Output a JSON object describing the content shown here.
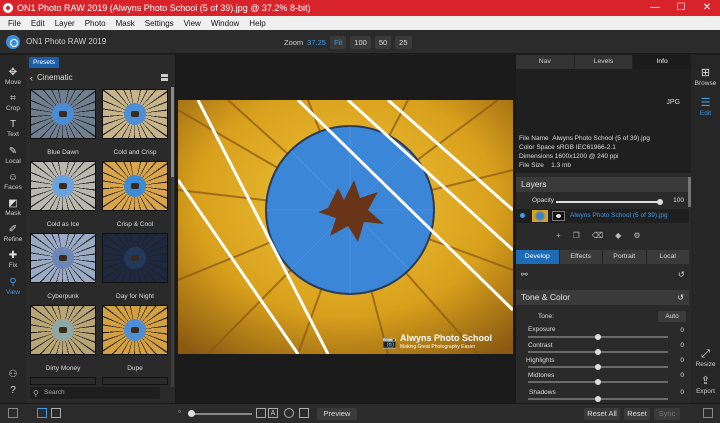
{
  "window": {
    "title": "ON1 Photo RAW 2019 (Alwyns Photo School (5 of 39).jpg @ 37.2% 8-bit)",
    "controls": [
      "—",
      "☐",
      "✕"
    ]
  },
  "menu": [
    "File",
    "Edit",
    "Layer",
    "Photo",
    "Mask",
    "Settings",
    "View",
    "Window",
    "Help"
  ],
  "header": {
    "app_name": "ON1 Photo RAW 2019",
    "zoom_label": "Zoom",
    "zoom_value": "37.25",
    "zoom_buttons": [
      "Fit",
      "100",
      "50",
      "25"
    ]
  },
  "tools": [
    {
      "label": "Move",
      "icon": "✥"
    },
    {
      "label": "Crop",
      "icon": "⌗"
    },
    {
      "label": "Text",
      "icon": "T"
    },
    {
      "label": "Local",
      "icon": "✎"
    },
    {
      "label": "Faces",
      "icon": "☺"
    },
    {
      "label": "Mask",
      "icon": "◩"
    },
    {
      "label": "Refine",
      "icon": "✐"
    },
    {
      "label": "Fix",
      "icon": "✚"
    },
    {
      "label": "View",
      "icon": "⚲"
    }
  ],
  "tool_active": "View",
  "presets": {
    "tab": "Presets",
    "category": "Cinematic",
    "items": [
      {
        "label": "Blue Dawn",
        "tone": "#6f7f8f",
        "center": "#4a8dd6"
      },
      {
        "label": "Cold and Crisp",
        "tone": "#c8b48a",
        "center": "#4b8fd8"
      },
      {
        "label": "Cold as Ice",
        "tone": "#b9b8ae",
        "center": "#6aa3e0"
      },
      {
        "label": "Crisp & Cool",
        "tone": "#d8a54c",
        "center": "#3d8bd6"
      },
      {
        "label": "Cyberpunk",
        "tone": "#9aa9c4",
        "center": "#6c86b5"
      },
      {
        "label": "Day for Night",
        "tone": "#1e2940",
        "center": "#23395c"
      },
      {
        "label": "Dirty Money",
        "tone": "#b8a676",
        "center": "#8fa7a5"
      },
      {
        "label": "Dupe",
        "tone": "#d4a142",
        "center": "#4e8ed4"
      }
    ],
    "search_placeholder": "Search"
  },
  "photo": {
    "watermark_title": "Alwyns Photo School",
    "watermark_sub": "Making Great Photography Easier"
  },
  "right_panel": {
    "tabs": [
      "Nav",
      "Levels",
      "Info"
    ],
    "active_tab": "Info",
    "format": "JPG",
    "info": [
      {
        "k": "File Name",
        "v": "Alwyns Photo School (5 of 39).jpg"
      },
      {
        "k": "Color Space",
        "v": "sRGB IEC61966-2.1"
      },
      {
        "k": "Dimensions",
        "v": "1600x1200 @ 240 ppi"
      },
      {
        "k": "File Size",
        "v": "1.3 mb"
      }
    ],
    "layers": {
      "title": "Layers",
      "opacity_label": "Opacity",
      "opacity_value": "100",
      "opacity_level": 100,
      "layer_name": "Alwyns Photo School (5 of 39).jpg",
      "icons": [
        "+",
        "❐",
        "⌫",
        "◆",
        "⚙"
      ]
    },
    "module_tabs": [
      "Develop",
      "Effects",
      "Portrait",
      "Local"
    ],
    "active_module": "Develop",
    "tone_color": {
      "title": "Tone & Color",
      "tone_label": "Tone:",
      "auto_label": "Auto",
      "sliders": [
        {
          "label": "Exposure",
          "value": "0",
          "level": 0
        },
        {
          "label": "Contrast",
          "value": "0",
          "level": 0
        },
        {
          "label": "Highlights",
          "value": "0",
          "level": 0
        },
        {
          "label": "Midtones",
          "value": "0",
          "level": 0
        },
        {
          "label": "Shadows",
          "value": "0",
          "level": 0
        }
      ]
    }
  },
  "right_rail": {
    "items": [
      "Browse",
      "Edit",
      "Resize",
      "Export"
    ],
    "active": "Edit"
  },
  "bottom": {
    "preview": "Preview",
    "reset_all": "Reset All",
    "reset": "Reset",
    "sync": "Sync",
    "zoom_level": 0
  },
  "colors": {
    "accent": "#3d9be9",
    "titlebar": "#d8232a",
    "sky": "#3c86d8",
    "balloon_yellow": "#e2ad1f"
  }
}
